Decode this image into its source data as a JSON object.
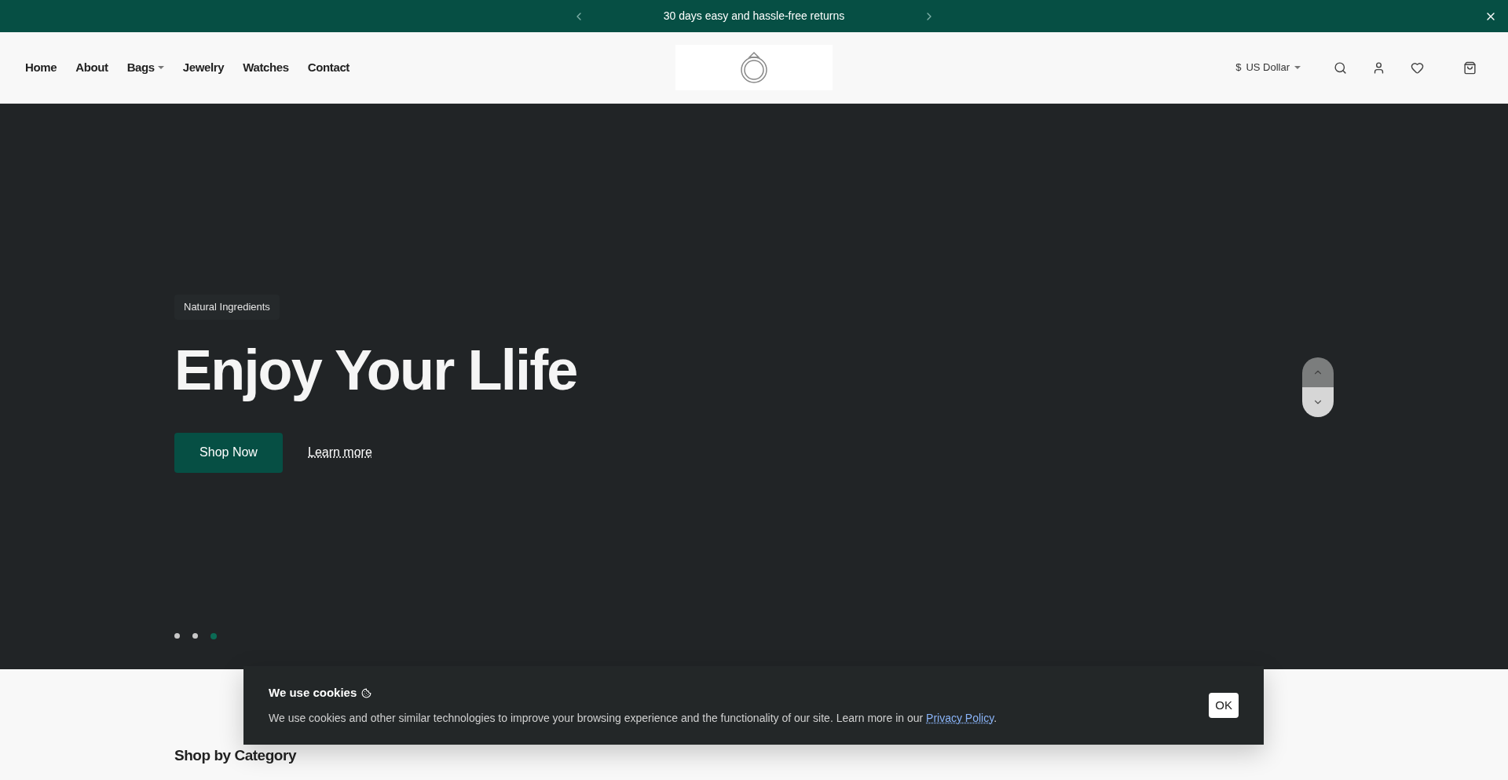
{
  "announcement": {
    "text": "30 days easy and hassle-free returns"
  },
  "nav": {
    "items": [
      {
        "label": "Home",
        "kind": "link"
      },
      {
        "label": "About",
        "kind": "link"
      },
      {
        "label": "Bags",
        "kind": "dropdown"
      },
      {
        "label": "Jewelry",
        "kind": "link"
      },
      {
        "label": "Watches",
        "kind": "link"
      },
      {
        "label": "Contact",
        "kind": "link"
      }
    ]
  },
  "currency": {
    "symbol": "$",
    "label": "US Dollar"
  },
  "hero": {
    "badge": "Natural Ingredients",
    "title": "Enjoy Your Llife",
    "primary_button": "Shop Now",
    "secondary_link": "Learn more",
    "dots": [
      {
        "selected": false
      },
      {
        "selected": false
      },
      {
        "selected": true
      }
    ]
  },
  "section": {
    "heading": "Shop by Category"
  },
  "cookie_banner": {
    "title": "We use cookies",
    "text": "We use cookies and other similar technologies to improve your browsing experience and the functionality of our site. Learn more in our",
    "link": "Privacy Policy",
    "after_link": ".",
    "button": "OK"
  }
}
